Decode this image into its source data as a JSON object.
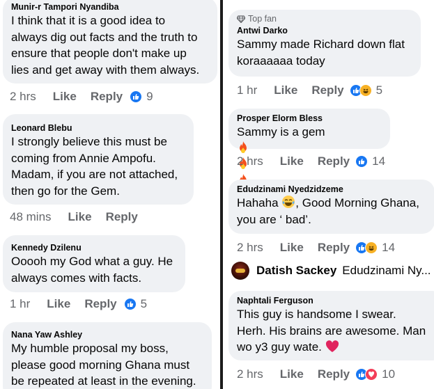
{
  "left": {
    "comments": [
      {
        "author": "Munir-r Tampori Nyandiba",
        "text": "I think that it is a good idea to\nalways dig out facts and the truth to\nensure that people don't make up\nlies and get away with them always.",
        "time": "2 hrs",
        "like": "Like",
        "reply": "Reply",
        "reactions": [
          "like"
        ],
        "count": "9"
      },
      {
        "author": "Leonard Blebu",
        "text": "I strongly believe this must be\ncoming from  Annie Ampofu.\nMadam, if you are not attached,\nthen go for the Gem.",
        "time": "48 mins",
        "like": "Like",
        "reply": "Reply",
        "reactions": [],
        "count": ""
      },
      {
        "author": "Kennedy Dzilenu",
        "text": "Ooooh my God what a guy. He\nalways comes with facts.",
        "time": "1 hr",
        "like": "Like",
        "reply": "Reply",
        "reactions": [
          "like"
        ],
        "count": "5"
      },
      {
        "author": "Nana Yaw Ashley",
        "text": "My humble proposal my boss,\nplease good morning Ghana must\nbe repeated at least in the evening.",
        "time": "",
        "like": "",
        "reply": "",
        "reactions": [],
        "count": ""
      }
    ]
  },
  "right": {
    "comments": [
      {
        "badge": "Top fan",
        "author": "Antwi Darko",
        "text": "Sammy made Richard down flat\nkoraaaaaa today",
        "time": "1 hr",
        "like": "Like",
        "reply": "Reply",
        "reactions": [
          "like",
          "haha"
        ],
        "count": "5"
      },
      {
        "author": "Prosper Elorm Bless",
        "text": "Sammy is a gem",
        "emojis": [
          "fire-emoji",
          "fire-emoji",
          "fire-emoji"
        ],
        "time": "2 hrs",
        "like": "Like",
        "reply": "Reply",
        "reactions": [
          "like"
        ],
        "count": "14"
      },
      {
        "author": "Edudzinami Nyedzidzeme",
        "text_a": "Hahaha ",
        "text_b": ", Good Morning Ghana,\nyou are ‘ bad’.",
        "emoji": "tears-of-joy-emoji",
        "time": "2 hrs",
        "like": "Like",
        "reply": "Reply",
        "reactions": [
          "like",
          "haha"
        ],
        "count": "14"
      }
    ],
    "reply_preview": {
      "author": "Datish Sackey",
      "text": "Edudzinami Ny..."
    },
    "last_comment": {
      "author": "Naphtali Ferguson",
      "text": "This guy is handsome I swear.\nHerh. His brains are awesome. Man\nwo y3 guy wate.",
      "emoji": "red-heart-emoji",
      "time": "2 hrs",
      "like": "Like",
      "reply": "Reply",
      "reactions": [
        "like",
        "love"
      ],
      "count": "10"
    }
  },
  "colors": {
    "bubble": "#eff1f4",
    "meta_text": "#65676b",
    "like_blue": "#1877f2",
    "love_red": "#f33e58",
    "haha_yellow": "#f7b125",
    "divider": "#1c1c1c"
  }
}
